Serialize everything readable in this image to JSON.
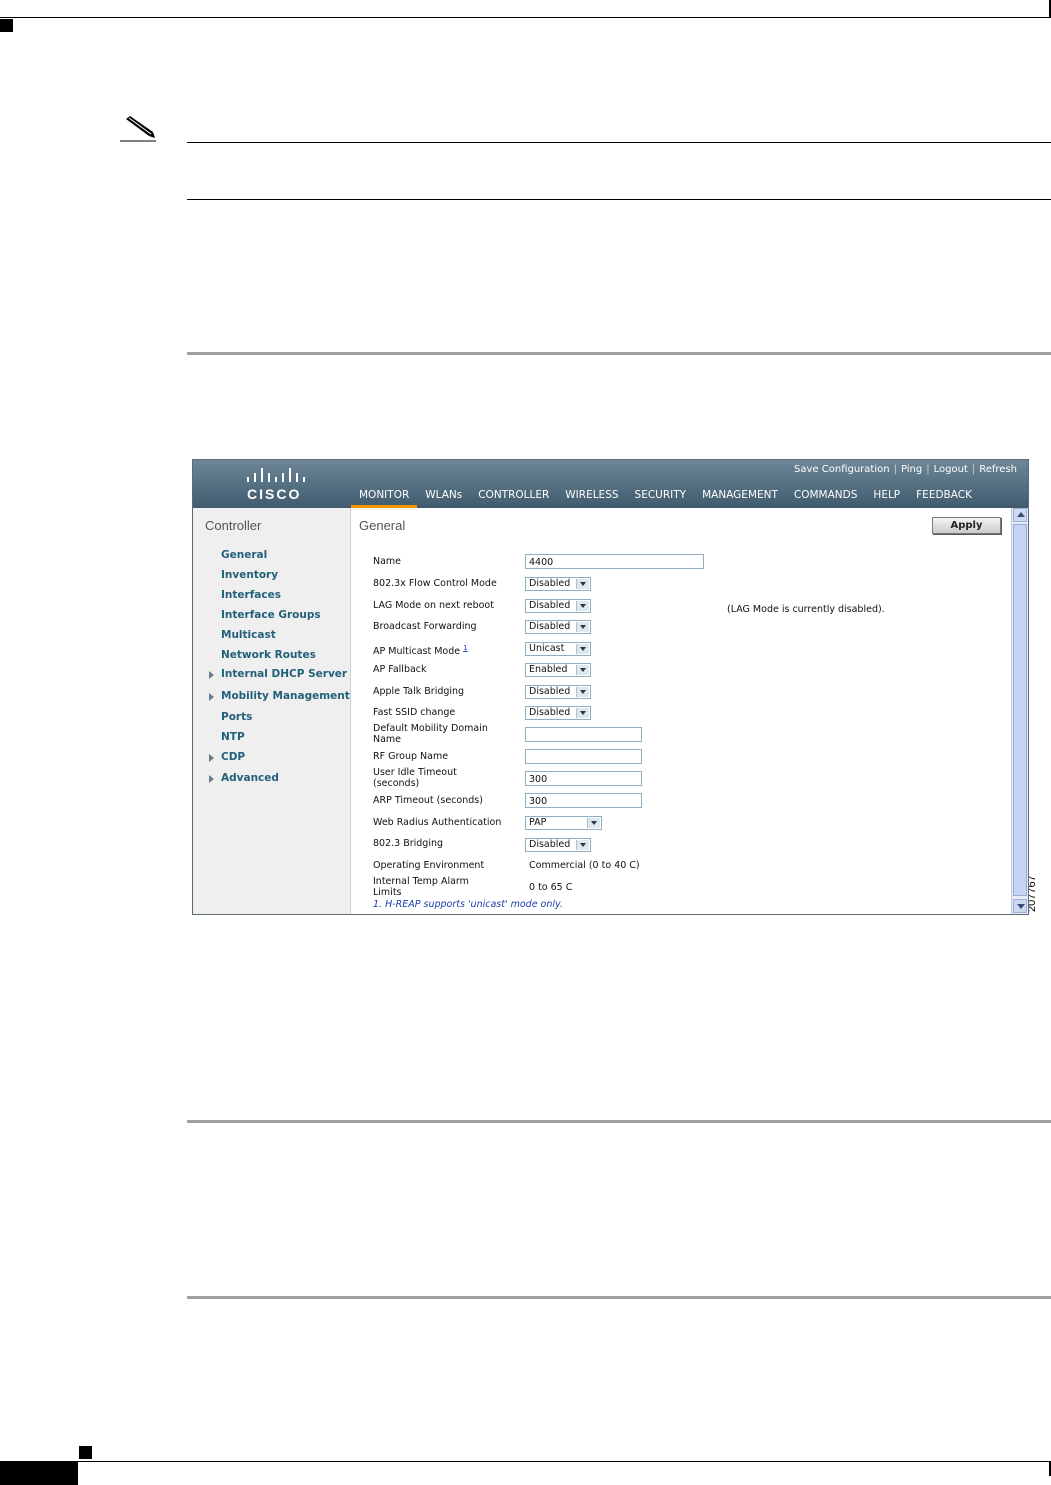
{
  "figure_id": "207767",
  "app": {
    "brand": "CISCO",
    "top_links": [
      "Save Configuration",
      "Ping",
      "Logout",
      "Refresh"
    ],
    "nav": [
      "MONITOR",
      "WLANs",
      "CONTROLLER",
      "WIRELESS",
      "SECURITY",
      "MANAGEMENT",
      "COMMANDS",
      "HELP",
      "FEEDBACK"
    ],
    "active_nav": "MONITOR"
  },
  "sidebar": {
    "title": "Controller",
    "items": [
      {
        "label": "General",
        "expandable": false
      },
      {
        "label": "Inventory",
        "expandable": false
      },
      {
        "label": "Interfaces",
        "expandable": false
      },
      {
        "label": "Interface Groups",
        "expandable": false
      },
      {
        "label": "Multicast",
        "expandable": false
      },
      {
        "label": "Network Routes",
        "expandable": false
      },
      {
        "label": "Internal DHCP Server",
        "expandable": true
      },
      {
        "label": "Mobility Management",
        "expandable": true
      },
      {
        "label": "Ports",
        "expandable": false
      },
      {
        "label": "NTP",
        "expandable": false
      },
      {
        "label": "CDP",
        "expandable": true
      },
      {
        "label": "Advanced",
        "expandable": true
      }
    ]
  },
  "main": {
    "title": "General",
    "apply_label": "Apply",
    "lag_note": "(LAG Mode is currently disabled).",
    "ap_multicast_footnote_ref": "1",
    "fields": {
      "name": {
        "label": "Name",
        "value": "4400"
      },
      "flow_control": {
        "label": "802.3x Flow Control Mode",
        "value": "Disabled"
      },
      "lag_mode": {
        "label": "LAG Mode on next reboot",
        "value": "Disabled"
      },
      "broadcast": {
        "label": "Broadcast Forwarding",
        "value": "Disabled"
      },
      "ap_multicast": {
        "label": "AP Multicast Mode",
        "value": "Unicast"
      },
      "ap_fallback": {
        "label": "AP Fallback",
        "value": "Enabled"
      },
      "apple_talk": {
        "label": "Apple Talk Bridging",
        "value": "Disabled"
      },
      "fast_ssid": {
        "label": "Fast SSID change",
        "value": "Disabled"
      },
      "mobility_domain": {
        "label_line1": "Default Mobility Domain",
        "label_line2": "Name",
        "value": ""
      },
      "rf_group": {
        "label": "RF Group Name",
        "value": ""
      },
      "idle_timeout": {
        "label_line1": "User Idle Timeout",
        "label_line2": "(seconds)",
        "value": "300"
      },
      "arp_timeout": {
        "label": "ARP Timeout (seconds)",
        "value": "300"
      },
      "web_radius": {
        "label": "Web Radius Authentication",
        "value": "PAP"
      },
      "bridging_8023": {
        "label": "802.3 Bridging",
        "value": "Disabled"
      },
      "operating_env": {
        "label": "Operating Environment",
        "value": "Commercial (0 to 40 C)"
      },
      "temp_alarm": {
        "label_line1": "Internal Temp Alarm",
        "label_line2": "Limits",
        "value": "0 to 65 C"
      }
    },
    "footnote": "1. H-REAP supports 'unicast' mode only."
  }
}
